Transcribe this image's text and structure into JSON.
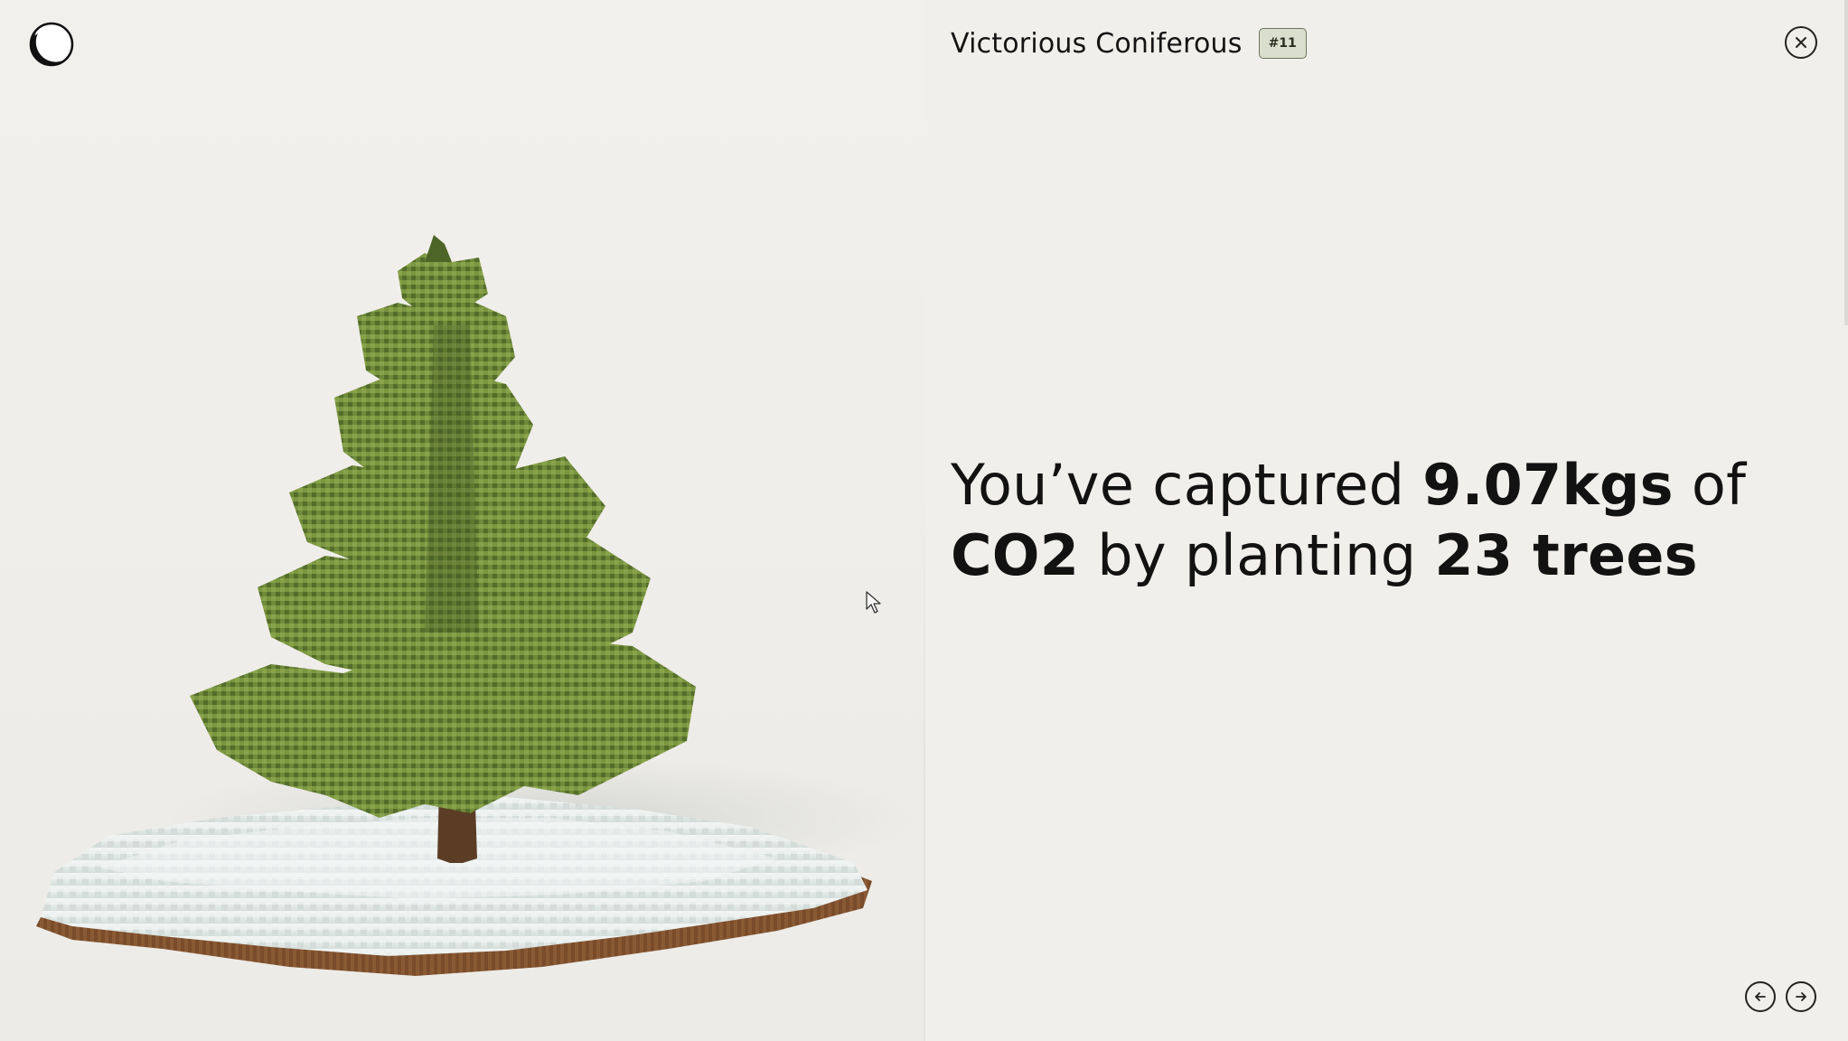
{
  "header": {
    "title": "Victorious Coniferous",
    "badge": "#11"
  },
  "logo": {
    "icon": "moon-globe-logo"
  },
  "headline": {
    "part1": "You’ve captured ",
    "kgs": "9.07kgs",
    "part2": " of ",
    "co2": "CO2",
    "part3": " by planting ",
    "trees": "23 trees"
  },
  "icons": {
    "close": "close-icon",
    "prev": "arrow-left-icon",
    "next": "arrow-right-icon"
  },
  "colors": {
    "background": "#f1efeb",
    "badge_bg": "#d9decd",
    "tree_green": "#6f8a3a",
    "snow": "#e6ece9",
    "soil": "#8a5a35"
  }
}
